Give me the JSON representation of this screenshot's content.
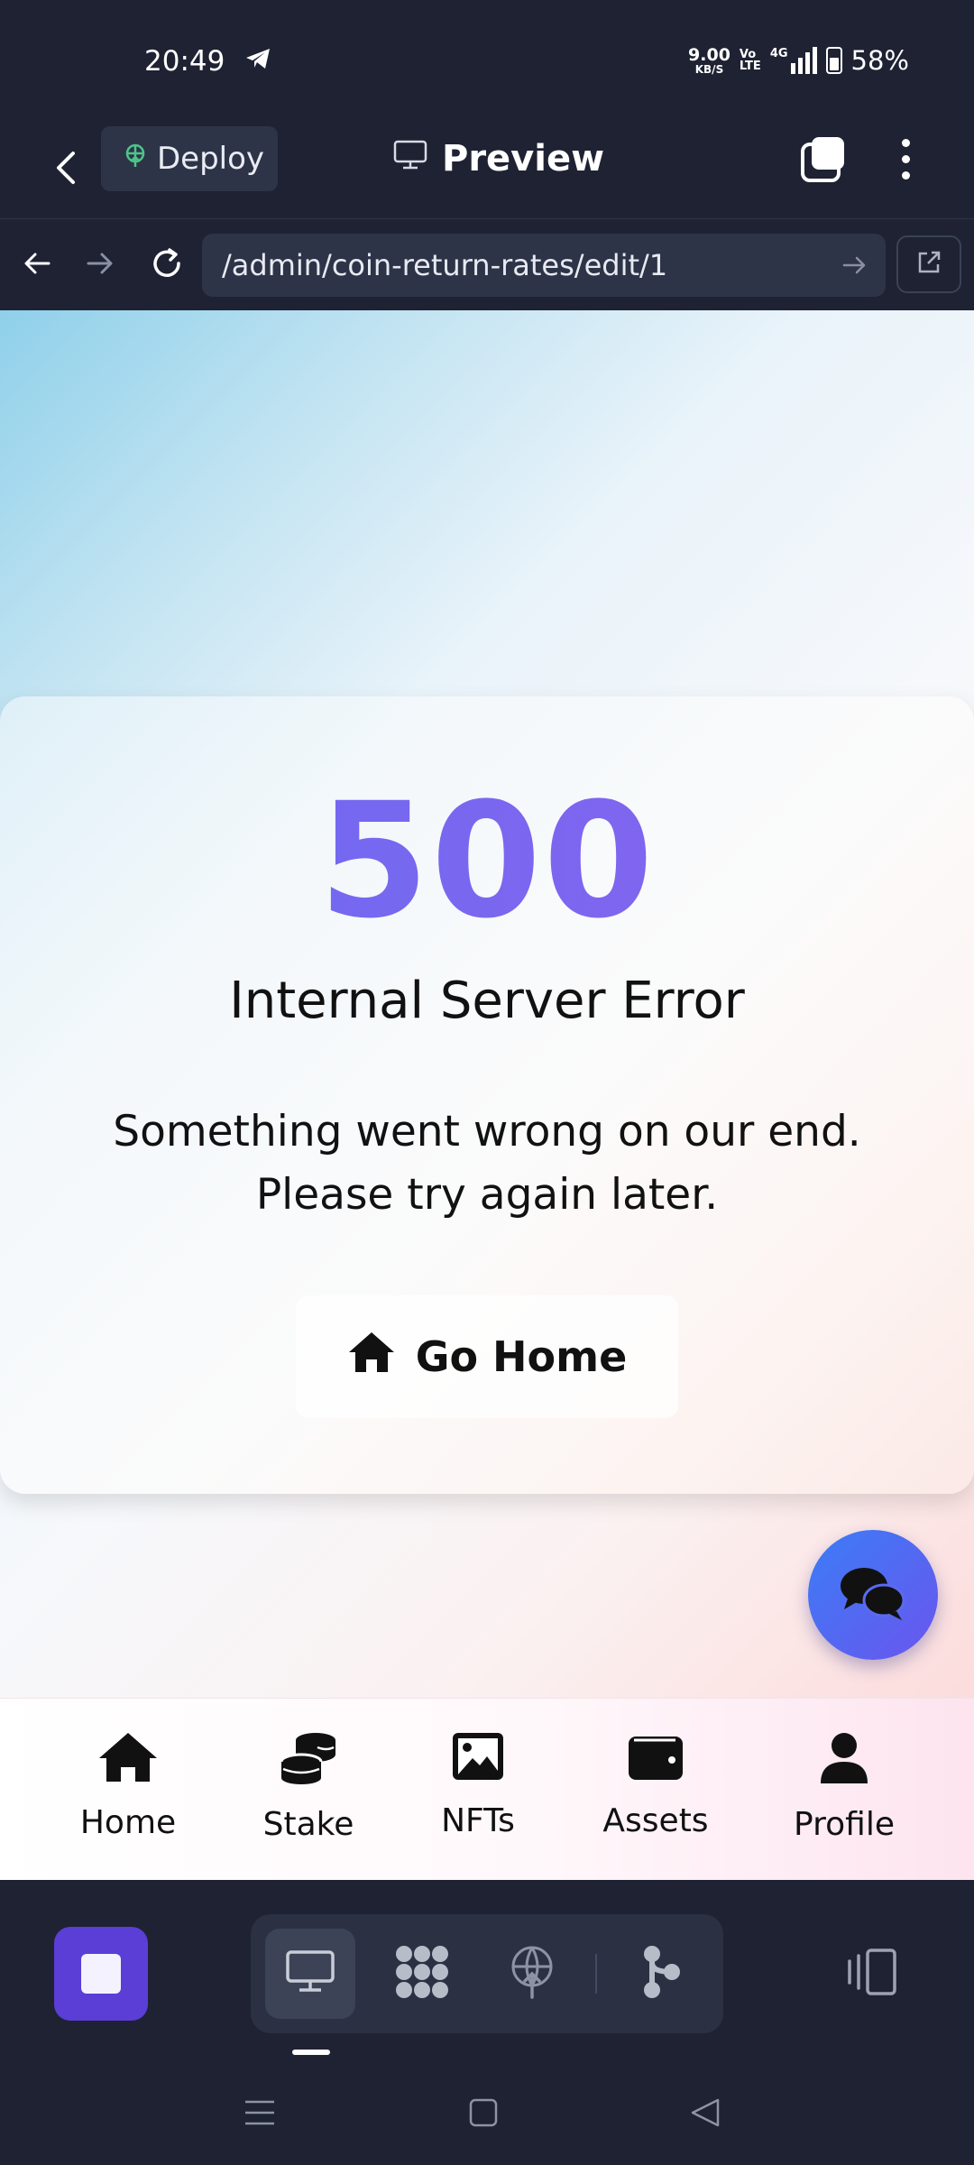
{
  "status_bar": {
    "time": "20:49",
    "net_speed_value": "9.00",
    "net_speed_unit": "KB/S",
    "volte_top": "Vo",
    "volte_bottom": "LTE",
    "network": "4G",
    "battery": "58%"
  },
  "app_header": {
    "deploy_label": "Deploy",
    "preview_label": "Preview"
  },
  "url_bar": {
    "url": "/admin/coin-return-rates/edit/1"
  },
  "error_page": {
    "code": "500",
    "title": "Internal Server Error",
    "message_line1": "Something went wrong on our end.",
    "message_line2": "Please try again later.",
    "home_button": "Go Home"
  },
  "bottom_nav": {
    "items": [
      {
        "label": "Home",
        "icon": "home-icon"
      },
      {
        "label": "Stake",
        "icon": "coins-icon"
      },
      {
        "label": "NFTs",
        "icon": "image-icon"
      },
      {
        "label": "Assets",
        "icon": "wallet-icon"
      },
      {
        "label": "Profile",
        "icon": "user-icon"
      }
    ]
  },
  "ide_toolbar": {
    "active_tab": "desktop-preview",
    "tabs": [
      "monitor-icon",
      "grid-dots-icon",
      "globe-deploy-icon",
      "git-branch-icon"
    ]
  },
  "colors": {
    "app_bg": "#1e2233",
    "accent_purple": "#5a3ed6",
    "error_code_gradient_start": "#6a6cf0",
    "error_code_gradient_end": "#8a62ef",
    "chat_fab_gradient_start": "#3b7df5",
    "chat_fab_gradient_end": "#6a55ee"
  }
}
